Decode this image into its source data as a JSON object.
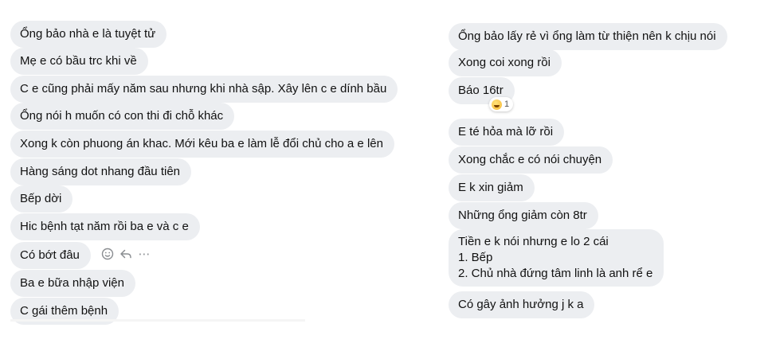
{
  "left_messages": [
    {
      "text": "Ổng bảo nhà e là tuyệt tử"
    },
    {
      "text": "Mẹ e có bầu trc khi về"
    },
    {
      "text": "C e cũng phải mấy năm sau nhưng khi nhà sập.  Xây lên c e dính bầu"
    },
    {
      "text": "Ổng nói h muốn có con thi đi chỗ khác"
    },
    {
      "text": "Xong k còn phuong án khac. Mới kêu ba e làm lễ đổi chủ cho a e lên"
    },
    {
      "text": "Hàng sáng dot nhang đầu tiên"
    },
    {
      "text": "Bếp dời"
    },
    {
      "text": "Hic bệnh tạt năm rồi ba e và c e"
    },
    {
      "text": "Có bớt đâu"
    },
    {
      "text": "Ba e bữa nhập viện"
    },
    {
      "text": "C gái thêm bệnh"
    }
  ],
  "right_messages": [
    {
      "text": "Ổng bảo lấy rẻ vì ổng làm từ thiện nên k chịu nói"
    },
    {
      "text": "Xong coi xong rồi"
    },
    {
      "text": "Báo 16tr"
    },
    {
      "text": "E té hỏa mà lỡ rồi"
    },
    {
      "text": "Xong chắc e có nói chuyện"
    },
    {
      "text": "E k xin giảm"
    },
    {
      "text": "Những ổng giảm còn 8tr"
    },
    {
      "lines": [
        "Tiền e k nói nhưng e lo 2 cái",
        "1. Bếp",
        "2. Chủ nhà đứng tâm linh là anh rể e"
      ]
    },
    {
      "text": "Có gây ảnh hưởng j k a"
    }
  ],
  "reaction": {
    "emoji": "grinning-sweat-emoji",
    "count": "1"
  },
  "hover_actions": {
    "icons": [
      "smile-icon",
      "reply-icon",
      "more-icon"
    ],
    "more_label": "⋯"
  },
  "colors": {
    "bubble_bg": "#eceef1",
    "text": "#111111",
    "icon": "#8a8d91",
    "background": "#ffffff"
  }
}
